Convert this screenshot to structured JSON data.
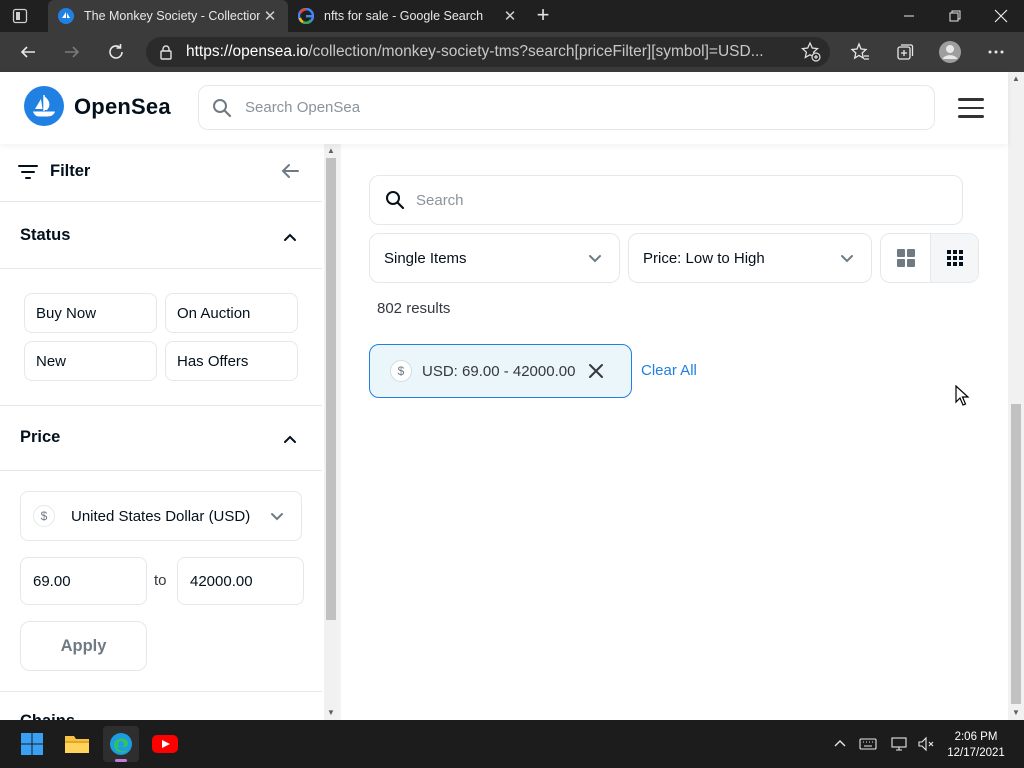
{
  "browser": {
    "tabs": [
      {
        "title": "The Monkey Society - Collection",
        "favicon": "opensea-icon",
        "active": true
      },
      {
        "title": "nfts for sale - Google Search",
        "favicon": "google-icon",
        "active": false
      }
    ],
    "url_host": "https://opensea.io",
    "url_rest": "/collection/monkey-society-tms?search[priceFilter][symbol]=USD..."
  },
  "header": {
    "brand": "OpenSea",
    "search_placeholder": "Search OpenSea"
  },
  "sidebar": {
    "filter_label": "Filter",
    "status": {
      "title": "Status",
      "options": [
        "Buy Now",
        "On Auction",
        "New",
        "Has Offers"
      ]
    },
    "price": {
      "title": "Price",
      "currency_symbol": "$",
      "currency": "United States Dollar (USD)",
      "min": "69.00",
      "to_label": "to",
      "max": "42000.00",
      "apply_label": "Apply"
    },
    "next_section": "Chains"
  },
  "main": {
    "search_placeholder": "Search",
    "items_select": "Single Items",
    "sort_select": "Price: Low to High",
    "results": "802 results",
    "chip": {
      "symbol": "$",
      "label": "USD: 69.00 - 42000.00"
    },
    "clear_all": "Clear All"
  },
  "taskbar": {
    "time": "2:06 PM",
    "date": "12/17/2021"
  },
  "colors": {
    "accent": "#2081e2",
    "chip_bg": "#eaf6fa",
    "border": "#e5e8eb",
    "text": "#04111d"
  }
}
